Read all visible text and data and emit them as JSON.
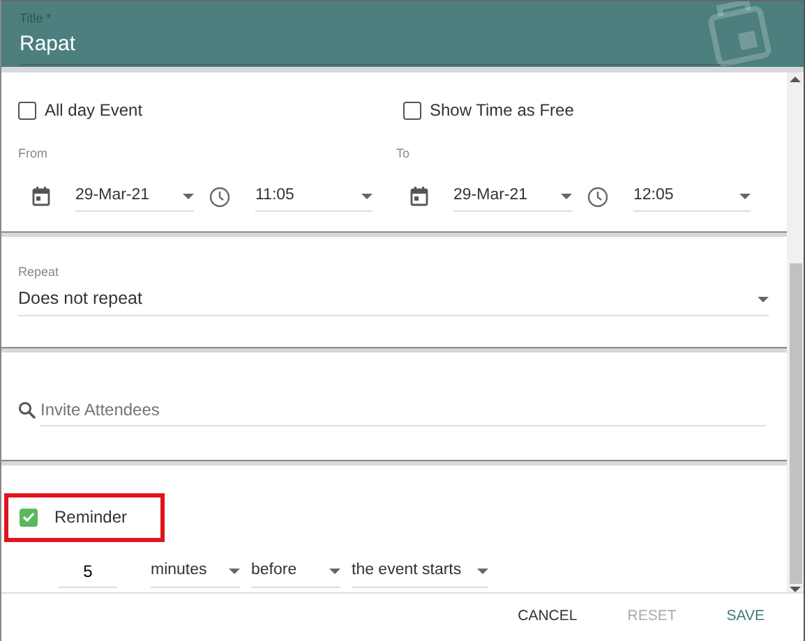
{
  "header": {
    "title_label": "Title *",
    "title_value": "Rapat"
  },
  "options": [
    {
      "label": "All day Event",
      "checked": false
    },
    {
      "label": "Show Time as Free",
      "checked": false
    }
  ],
  "range": [
    {
      "label": "From",
      "date": "29-Mar-21",
      "time": "11:05"
    },
    {
      "label": "To",
      "date": "29-Mar-21",
      "time": "12:05"
    }
  ],
  "repeat": {
    "label": "Repeat",
    "value": "Does not repeat"
  },
  "attendees": {
    "placeholder": "Invite Attendees"
  },
  "reminder": {
    "label": "Reminder",
    "checked": true,
    "highlighted": true,
    "amount": "5",
    "unit": "minutes",
    "relation": "before",
    "anchor": "the event starts"
  },
  "buttons": [
    {
      "label": "CANCEL",
      "kind": "plain",
      "disabled": false
    },
    {
      "label": "RESET",
      "kind": "plain",
      "disabled": true
    },
    {
      "label": "SAVE",
      "kind": "primary",
      "disabled": false
    }
  ]
}
